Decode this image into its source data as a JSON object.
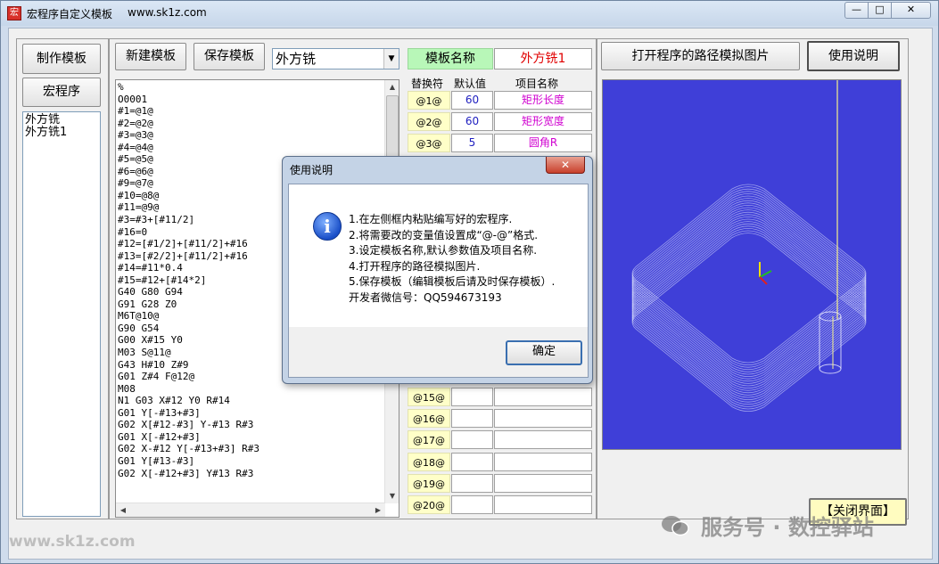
{
  "window": {
    "icon_glyph": "宏",
    "title": "宏程序自定义模板",
    "title_url": "www.sk1z.com",
    "controls": {
      "min": "—",
      "max": "□",
      "close": "✕"
    }
  },
  "left_panel": {
    "make_template": "制作模板",
    "macro_program": "宏程序",
    "templates": [
      "外方铣",
      "外方铣1"
    ]
  },
  "toolbar": {
    "new_template": "新建模板",
    "save_template": "保存模板",
    "combo_value": "外方铣",
    "open_image": "打开程序的路径模拟图片",
    "usage": "使用说明"
  },
  "template_name": {
    "label": "模板名称",
    "value": "外方铣1"
  },
  "param_headers": {
    "tag": "替换符",
    "default": "默认值",
    "name": "项目名称"
  },
  "params_top": [
    {
      "tag": "@1@",
      "default": "60",
      "name": "矩形长度"
    },
    {
      "tag": "@2@",
      "default": "60",
      "name": "矩形宽度"
    },
    {
      "tag": "@3@",
      "default": "5",
      "name": "圆角R"
    }
  ],
  "params_bottom": [
    {
      "tag": "@15@",
      "default": "",
      "name": ""
    },
    {
      "tag": "@16@",
      "default": "",
      "name": ""
    },
    {
      "tag": "@17@",
      "default": "",
      "name": ""
    },
    {
      "tag": "@18@",
      "default": "",
      "name": ""
    },
    {
      "tag": "@19@",
      "default": "",
      "name": ""
    },
    {
      "tag": "@20@",
      "default": "",
      "name": ""
    }
  ],
  "code_lines": [
    "%",
    "O0001",
    "#1=@1@",
    "#2=@2@",
    "#3=@3@",
    "#4=@4@",
    "#5=@5@",
    "#6=@6@",
    "#9=@7@",
    "#10=@8@",
    "#11=@9@",
    "#3=#3+[#11/2]",
    "#16=0",
    "#12=[#1/2]+[#11/2]+#16",
    "#13=[#2/2]+[#11/2]+#16",
    "#14=#11*0.4",
    "#15=#12+[#14*2]",
    "G40 G80 G94",
    "G91 G28 Z0",
    "M6T@10@",
    "G90 G54",
    "G00 X#15 Y0",
    "M03 S@11@",
    "G43 H#10 Z#9",
    "G01 Z#4 F@12@",
    "M08",
    "N1 G03 X#12 Y0 R#14",
    "G01 Y[-#13+#3]",
    "G02 X[#12-#3] Y-#13 R#3",
    "G01 X[-#12+#3]",
    "G02 X-#12 Y[-#13+#3] R#3",
    "G01 Y[#13-#3]",
    "G02 X[-#12+#3] Y#13 R#3"
  ],
  "close_button": "【关闭界面】",
  "dialog": {
    "title": "使用说明",
    "close": "✕",
    "icon": "i",
    "lines": [
      "1.在左侧框内粘贴编写好的宏程序.",
      "2.将需要改的变量值设置成“@-@”格式.",
      "3.设定模板名称,默认参数值及项目名称.",
      "4.打开程序的路径模拟图片.",
      "5.保存模板（编辑模板后请及时保存模板）.",
      "开发者微信号：QQ594673193"
    ],
    "ok": "确定"
  },
  "watermarks": {
    "left": "www.sk1z.com",
    "right": "服务号 · 数控驿站"
  },
  "colors": {
    "preview_bg": "#3f3fd8",
    "template_label_bg": "#b8f7b8",
    "tag_bg": "#ffffc8",
    "name_text": "#d000d0",
    "value_text": "#e00000"
  }
}
